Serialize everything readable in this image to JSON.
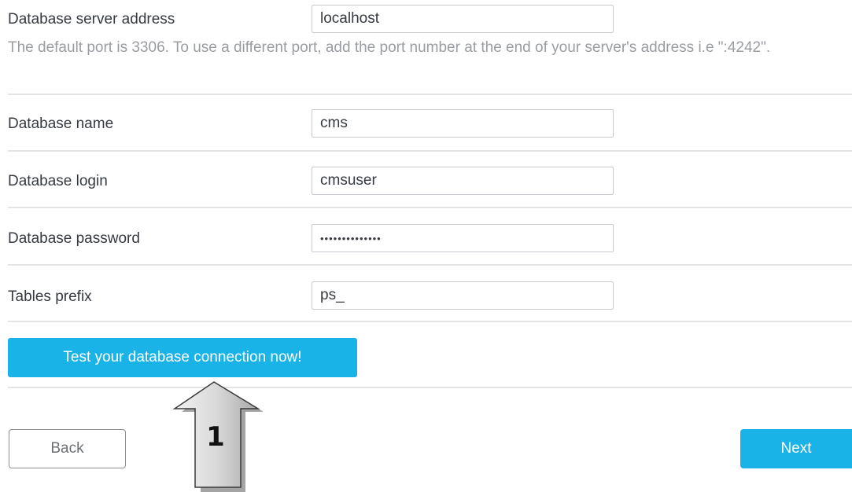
{
  "form": {
    "server_address": {
      "label": "Database server address",
      "value": "localhost",
      "hint": "The default port is 3306. To use a different port, add the port number at the end of your server's address i.e \":4242\"."
    },
    "db_name": {
      "label": "Database name",
      "value": "cms"
    },
    "db_login": {
      "label": "Database login",
      "value": "cmsuser"
    },
    "db_password": {
      "label": "Database password",
      "value": "••••••••••••••"
    },
    "tables_prefix": {
      "label": "Tables prefix",
      "value": "ps_"
    }
  },
  "actions": {
    "test_connection_label": "Test your database connection now!",
    "back_label": "Back",
    "next_label": "Next"
  },
  "annotation": {
    "number": "1",
    "icon": "up-arrow-icon"
  },
  "colors": {
    "accent": "#1ab3e8",
    "text": "#363a41",
    "hint": "#9a9da1",
    "divider": "#e2e4e6"
  }
}
